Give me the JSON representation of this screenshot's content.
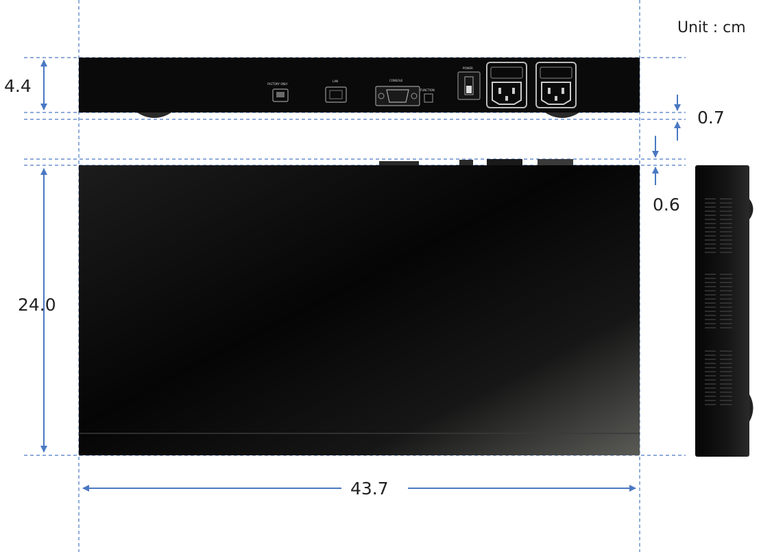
{
  "unit_label": "Unit : cm",
  "dimensions": {
    "height": "4.4",
    "foot_height": "0.7",
    "rear_protrusion": "0.6",
    "depth": "24.0",
    "width": "43.7"
  },
  "rear_panel": {
    "labels": [
      "FACTORY ONLY",
      "LAN",
      "CONSOLE",
      "FUNCTION",
      "POWER"
    ]
  },
  "colors": {
    "guide_line": "#4a78c2",
    "chassis": "#0a0a0a",
    "background": "#ffffff"
  }
}
